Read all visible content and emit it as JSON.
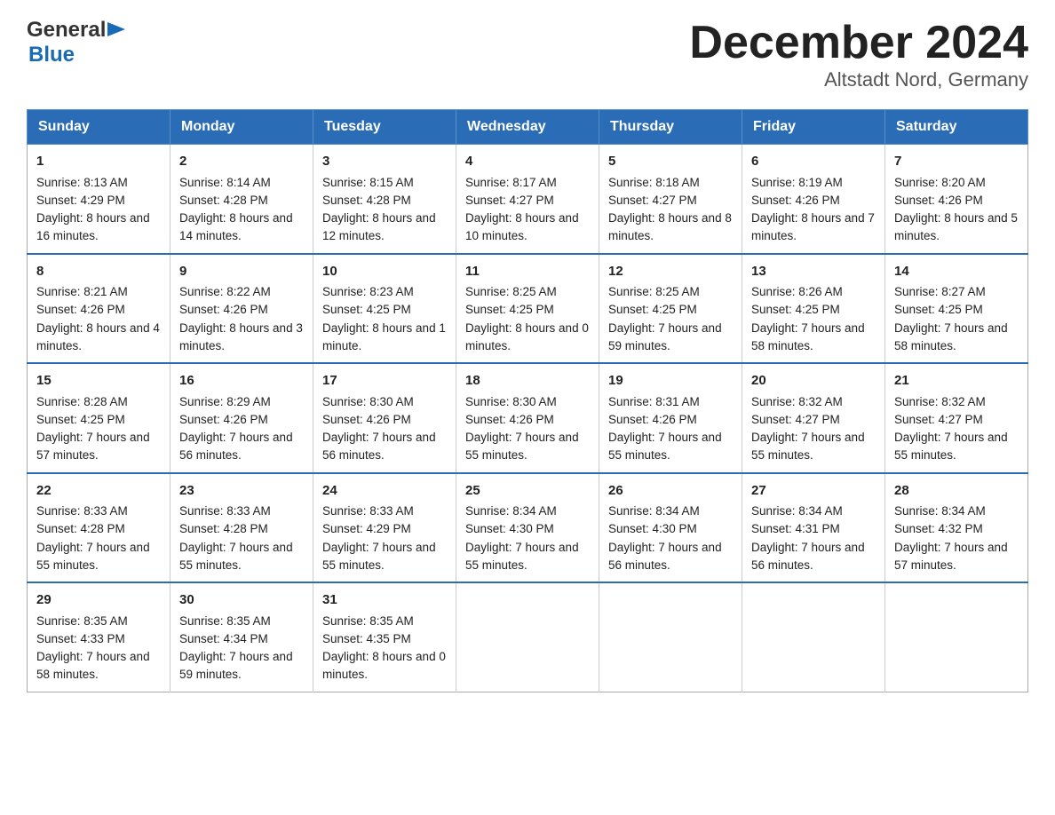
{
  "header": {
    "logo_general": "General",
    "logo_blue": "Blue",
    "title": "December 2024",
    "subtitle": "Altstadt Nord, Germany"
  },
  "days_of_week": [
    "Sunday",
    "Monday",
    "Tuesday",
    "Wednesday",
    "Thursday",
    "Friday",
    "Saturday"
  ],
  "weeks": [
    [
      {
        "day": "1",
        "sunrise": "Sunrise: 8:13 AM",
        "sunset": "Sunset: 4:29 PM",
        "daylight": "Daylight: 8 hours and 16 minutes."
      },
      {
        "day": "2",
        "sunrise": "Sunrise: 8:14 AM",
        "sunset": "Sunset: 4:28 PM",
        "daylight": "Daylight: 8 hours and 14 minutes."
      },
      {
        "day": "3",
        "sunrise": "Sunrise: 8:15 AM",
        "sunset": "Sunset: 4:28 PM",
        "daylight": "Daylight: 8 hours and 12 minutes."
      },
      {
        "day": "4",
        "sunrise": "Sunrise: 8:17 AM",
        "sunset": "Sunset: 4:27 PM",
        "daylight": "Daylight: 8 hours and 10 minutes."
      },
      {
        "day": "5",
        "sunrise": "Sunrise: 8:18 AM",
        "sunset": "Sunset: 4:27 PM",
        "daylight": "Daylight: 8 hours and 8 minutes."
      },
      {
        "day": "6",
        "sunrise": "Sunrise: 8:19 AM",
        "sunset": "Sunset: 4:26 PM",
        "daylight": "Daylight: 8 hours and 7 minutes."
      },
      {
        "day": "7",
        "sunrise": "Sunrise: 8:20 AM",
        "sunset": "Sunset: 4:26 PM",
        "daylight": "Daylight: 8 hours and 5 minutes."
      }
    ],
    [
      {
        "day": "8",
        "sunrise": "Sunrise: 8:21 AM",
        "sunset": "Sunset: 4:26 PM",
        "daylight": "Daylight: 8 hours and 4 minutes."
      },
      {
        "day": "9",
        "sunrise": "Sunrise: 8:22 AM",
        "sunset": "Sunset: 4:26 PM",
        "daylight": "Daylight: 8 hours and 3 minutes."
      },
      {
        "day": "10",
        "sunrise": "Sunrise: 8:23 AM",
        "sunset": "Sunset: 4:25 PM",
        "daylight": "Daylight: 8 hours and 1 minute."
      },
      {
        "day": "11",
        "sunrise": "Sunrise: 8:25 AM",
        "sunset": "Sunset: 4:25 PM",
        "daylight": "Daylight: 8 hours and 0 minutes."
      },
      {
        "day": "12",
        "sunrise": "Sunrise: 8:25 AM",
        "sunset": "Sunset: 4:25 PM",
        "daylight": "Daylight: 7 hours and 59 minutes."
      },
      {
        "day": "13",
        "sunrise": "Sunrise: 8:26 AM",
        "sunset": "Sunset: 4:25 PM",
        "daylight": "Daylight: 7 hours and 58 minutes."
      },
      {
        "day": "14",
        "sunrise": "Sunrise: 8:27 AM",
        "sunset": "Sunset: 4:25 PM",
        "daylight": "Daylight: 7 hours and 58 minutes."
      }
    ],
    [
      {
        "day": "15",
        "sunrise": "Sunrise: 8:28 AM",
        "sunset": "Sunset: 4:25 PM",
        "daylight": "Daylight: 7 hours and 57 minutes."
      },
      {
        "day": "16",
        "sunrise": "Sunrise: 8:29 AM",
        "sunset": "Sunset: 4:26 PM",
        "daylight": "Daylight: 7 hours and 56 minutes."
      },
      {
        "day": "17",
        "sunrise": "Sunrise: 8:30 AM",
        "sunset": "Sunset: 4:26 PM",
        "daylight": "Daylight: 7 hours and 56 minutes."
      },
      {
        "day": "18",
        "sunrise": "Sunrise: 8:30 AM",
        "sunset": "Sunset: 4:26 PM",
        "daylight": "Daylight: 7 hours and 55 minutes."
      },
      {
        "day": "19",
        "sunrise": "Sunrise: 8:31 AM",
        "sunset": "Sunset: 4:26 PM",
        "daylight": "Daylight: 7 hours and 55 minutes."
      },
      {
        "day": "20",
        "sunrise": "Sunrise: 8:32 AM",
        "sunset": "Sunset: 4:27 PM",
        "daylight": "Daylight: 7 hours and 55 minutes."
      },
      {
        "day": "21",
        "sunrise": "Sunrise: 8:32 AM",
        "sunset": "Sunset: 4:27 PM",
        "daylight": "Daylight: 7 hours and 55 minutes."
      }
    ],
    [
      {
        "day": "22",
        "sunrise": "Sunrise: 8:33 AM",
        "sunset": "Sunset: 4:28 PM",
        "daylight": "Daylight: 7 hours and 55 minutes."
      },
      {
        "day": "23",
        "sunrise": "Sunrise: 8:33 AM",
        "sunset": "Sunset: 4:28 PM",
        "daylight": "Daylight: 7 hours and 55 minutes."
      },
      {
        "day": "24",
        "sunrise": "Sunrise: 8:33 AM",
        "sunset": "Sunset: 4:29 PM",
        "daylight": "Daylight: 7 hours and 55 minutes."
      },
      {
        "day": "25",
        "sunrise": "Sunrise: 8:34 AM",
        "sunset": "Sunset: 4:30 PM",
        "daylight": "Daylight: 7 hours and 55 minutes."
      },
      {
        "day": "26",
        "sunrise": "Sunrise: 8:34 AM",
        "sunset": "Sunset: 4:30 PM",
        "daylight": "Daylight: 7 hours and 56 minutes."
      },
      {
        "day": "27",
        "sunrise": "Sunrise: 8:34 AM",
        "sunset": "Sunset: 4:31 PM",
        "daylight": "Daylight: 7 hours and 56 minutes."
      },
      {
        "day": "28",
        "sunrise": "Sunrise: 8:34 AM",
        "sunset": "Sunset: 4:32 PM",
        "daylight": "Daylight: 7 hours and 57 minutes."
      }
    ],
    [
      {
        "day": "29",
        "sunrise": "Sunrise: 8:35 AM",
        "sunset": "Sunset: 4:33 PM",
        "daylight": "Daylight: 7 hours and 58 minutes."
      },
      {
        "day": "30",
        "sunrise": "Sunrise: 8:35 AM",
        "sunset": "Sunset: 4:34 PM",
        "daylight": "Daylight: 7 hours and 59 minutes."
      },
      {
        "day": "31",
        "sunrise": "Sunrise: 8:35 AM",
        "sunset": "Sunset: 4:35 PM",
        "daylight": "Daylight: 8 hours and 0 minutes."
      },
      {
        "day": "",
        "sunrise": "",
        "sunset": "",
        "daylight": ""
      },
      {
        "day": "",
        "sunrise": "",
        "sunset": "",
        "daylight": ""
      },
      {
        "day": "",
        "sunrise": "",
        "sunset": "",
        "daylight": ""
      },
      {
        "day": "",
        "sunrise": "",
        "sunset": "",
        "daylight": ""
      }
    ]
  ]
}
